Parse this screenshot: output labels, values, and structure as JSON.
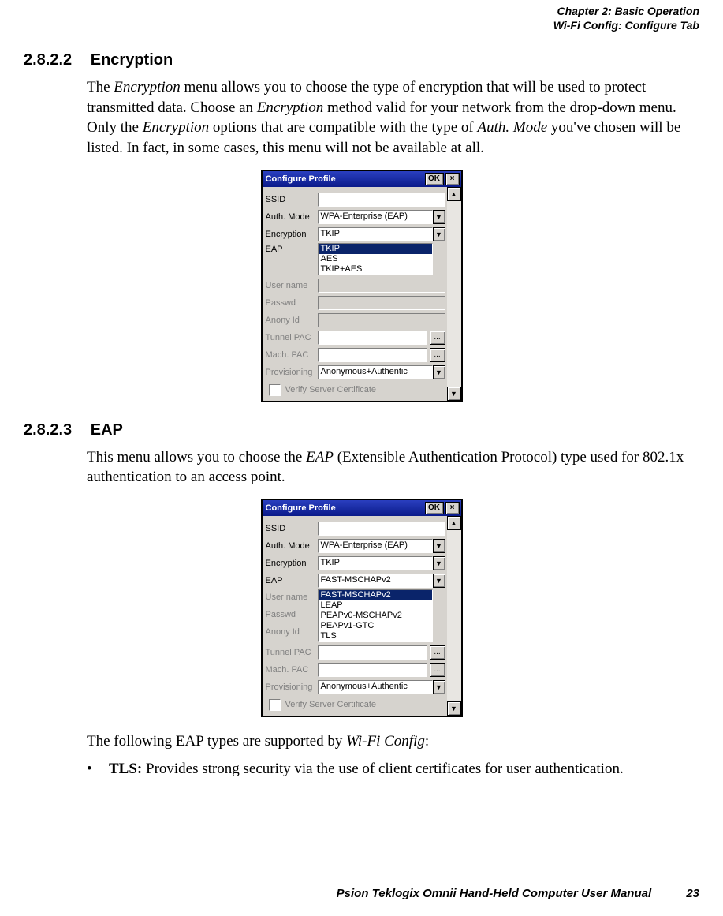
{
  "header": {
    "chapter": "Chapter 2:  Basic Operation",
    "section": "Wi-Fi Config: Configure Tab"
  },
  "s1": {
    "num": "2.8.2.2",
    "title": "Encryption",
    "p_pre": "The ",
    "p_em1": "Encryption",
    "p_mid1": " menu allows you to choose the type of encryption that will be used to protect transmitted data. Choose an ",
    "p_em2": "Encryption",
    "p_mid2": " method valid for your network from the drop-down menu. Only the ",
    "p_em3": "Encryption",
    "p_mid3": " options that are compatible with the type of ",
    "p_em4": "Auth. Mode",
    "p_end": " you've chosen will be listed. In fact, in some cases, this menu will not be available at all."
  },
  "s2": {
    "num": "2.8.2.3",
    "title": "EAP",
    "p_pre": "This menu allows you to choose the ",
    "p_em": "EAP",
    "p_post": " (Extensible Authentication Protocol) type used for 802.1x authentication to an access point.",
    "after_pre": "The following EAP types are supported by ",
    "after_em": "Wi-Fi Config",
    "after_post": ":",
    "bullet_mark": "•",
    "bullet_bold": "TLS:",
    "bullet_rest": " Provides strong security via the use of client certificates for user authentication."
  },
  "dlg": {
    "title": "Configure Profile",
    "ok": "OK",
    "close": "×",
    "ellipsis": "...",
    "arrow_down": "▼",
    "arrow_up": "▲",
    "labels": {
      "ssid": "SSID",
      "auth": "Auth. Mode",
      "enc": "Encryption",
      "eap": "EAP",
      "user": "User name",
      "pass": "Passwd",
      "anon": "Anony Id",
      "tunnel": "Tunnel PAC",
      "mach": "Mach. PAC",
      "prov": "Provisioning",
      "verify": "Verify Server Certificate"
    },
    "values": {
      "auth": "WPA-Enterprise (EAP)",
      "enc": "TKIP",
      "eap": "FAST-MSCHAPv2",
      "prov": "Anonymous+Authentic"
    },
    "enc_options": [
      "TKIP",
      "AES",
      "TKIP+AES"
    ],
    "eap_options": [
      "FAST-MSCHAPv2",
      "LEAP",
      "PEAPv0-MSCHAPv2",
      "PEAPv1-GTC",
      "TLS"
    ]
  },
  "footer": {
    "text": "Psion Teklogix Omnii Hand-Held Computer User Manual",
    "page": "23"
  }
}
